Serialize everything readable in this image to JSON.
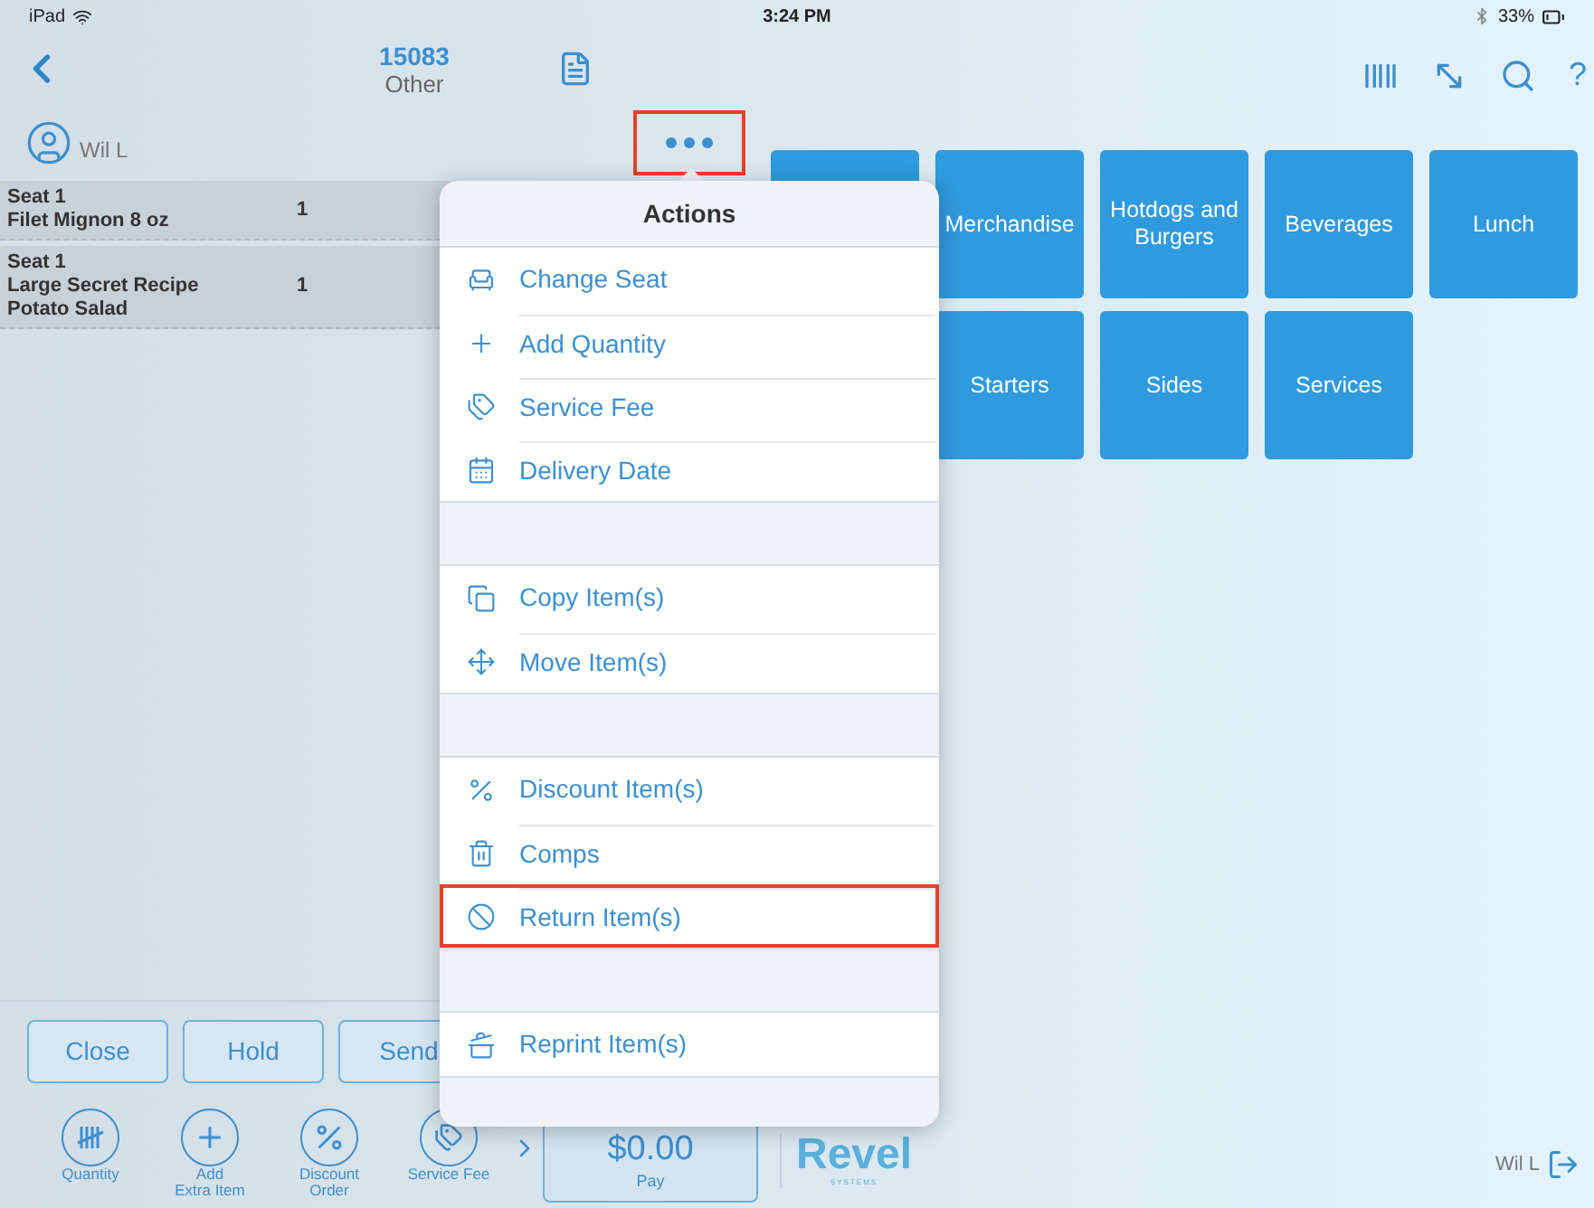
{
  "status_bar": {
    "device": "iPad",
    "time": "3:24 PM",
    "battery": "33%"
  },
  "header": {
    "order_number": "15083",
    "order_type": "Other",
    "help": "?"
  },
  "server": {
    "name": "Wil L"
  },
  "more_button": {
    "highlighted": true
  },
  "order_items": [
    {
      "seat": "Seat 1",
      "name": "Filet Mignon 8 oz",
      "quantity": "1"
    },
    {
      "seat": "Seat 1",
      "name": "Large Secret Recipe Potato Salad",
      "quantity": "1"
    }
  ],
  "order_buttons": [
    "Close",
    "Hold",
    "Send"
  ],
  "categories": [
    [
      "Merchandise",
      "Hotdogs and Burgers",
      "Beverages",
      "Lunch"
    ],
    [
      "Starters",
      "Sides",
      "Services"
    ]
  ],
  "actions": {
    "title": "Actions",
    "groups": [
      [
        {
          "label": "Change Seat",
          "highlighted": false
        },
        {
          "label": "Add Quantity",
          "highlighted": false
        },
        {
          "label": "Service Fee",
          "highlighted": false
        },
        {
          "label": "Delivery Date",
          "highlighted": false
        }
      ],
      [
        {
          "label": "Copy Item(s)",
          "highlighted": false
        },
        {
          "label": "Move Item(s)",
          "highlighted": false
        }
      ],
      [
        {
          "label": "Discount Item(s)",
          "highlighted": false
        },
        {
          "label": "Comps",
          "highlighted": false
        },
        {
          "label": "Return Item(s)",
          "highlighted": true
        }
      ],
      [
        {
          "label": "Reprint Item(s)",
          "highlighted": false
        }
      ]
    ]
  },
  "quick_actions": [
    "Quantity",
    "Add\nExtra Item",
    "Discount\nOrder",
    "Service Fee"
  ],
  "pay": {
    "amount": "$0.00",
    "label": "Pay"
  },
  "brand": {
    "name": "Revel",
    "tagline": "SYSTEMS"
  },
  "footer_user": "Wil L"
}
